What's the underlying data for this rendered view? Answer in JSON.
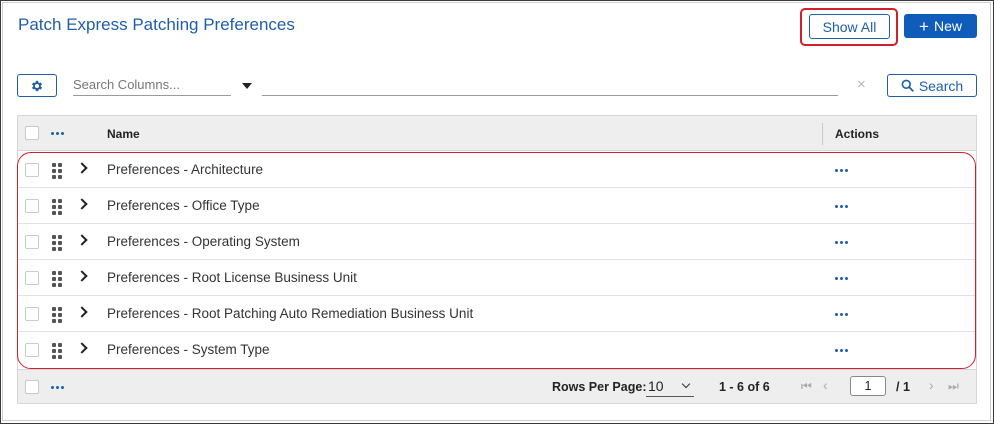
{
  "page": {
    "title": "Patch Express Patching Preferences"
  },
  "header": {
    "show_all_label": "Show All",
    "new_label": "New",
    "new_icon": "plus-icon"
  },
  "toolbar": {
    "settings_icon": "gear-icon",
    "search_columns_placeholder": "Search Columns...",
    "search_value": "",
    "clear_icon": "×",
    "search_label": "Search",
    "search_icon": "magnifier-icon"
  },
  "grid": {
    "columns": [
      "Name",
      "Actions"
    ],
    "rows": [
      {
        "name": "Preferences - Architecture"
      },
      {
        "name": "Preferences - Office Type"
      },
      {
        "name": "Preferences - Operating System"
      },
      {
        "name": "Preferences - Root License Business Unit"
      },
      {
        "name": "Preferences - Root Patching Auto Remediation Business Unit"
      },
      {
        "name": "Preferences - System Type"
      }
    ]
  },
  "footer": {
    "rows_per_page_label": "Rows Per Page:",
    "rows_per_page_value": "10",
    "range": "1 - 6 of 6",
    "current_page": "1",
    "total_pages": "/ 1"
  },
  "colors": {
    "accent": "#1f5fa8",
    "primary_button": "#0f5cbb",
    "highlight_ring": "#d0202a"
  }
}
